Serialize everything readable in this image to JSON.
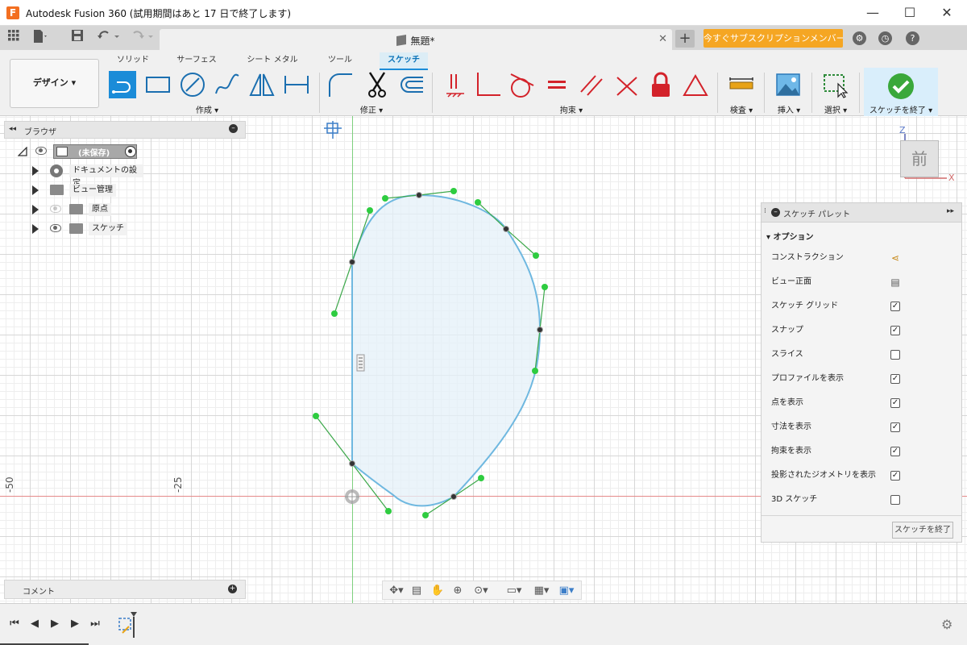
{
  "window": {
    "logo_letter": "F",
    "title": "Autodesk Fusion 360 (試用期間はあと 17 日で終了します)",
    "controls": {
      "minimize": "—",
      "maximize": "☐",
      "close": "✕"
    }
  },
  "tabbar": {
    "doc_tab_title": "無題*",
    "close": "✕",
    "new_tab": "+",
    "subscription_button": "今すぐサブスクリプションメンバーに...",
    "icons": [
      "grid-icon",
      "file-icon",
      "save-icon",
      "undo-icon",
      "redo-icon",
      "job-status-icon",
      "history-icon",
      "help-icon"
    ]
  },
  "ribbon": {
    "workspace": "デザイン ▾",
    "tabs": [
      {
        "label": "ソリッド",
        "active": false
      },
      {
        "label": "サーフェス",
        "active": false
      },
      {
        "label": "シート メタル",
        "active": false
      },
      {
        "label": "ツール",
        "active": false
      },
      {
        "label": "スケッチ",
        "active": true
      }
    ],
    "groups": {
      "create": "作成 ▾",
      "modify": "修正 ▾",
      "constraints": "拘束 ▾",
      "inspect": "検査 ▾",
      "insert": "挿入 ▾",
      "select": "選択 ▾",
      "finish": "スケッチを終了 ▾"
    },
    "accent": "#1b8cd8",
    "constraint_red": "#d3222a"
  },
  "browser": {
    "title": "ブラウザ",
    "root": "(未保存)",
    "items": [
      {
        "label": "ドキュメントの設定",
        "icon": "gear-icon"
      },
      {
        "label": "ビュー管理",
        "icon": "folder-icon"
      },
      {
        "label": "原点",
        "icon": "folder-icon"
      },
      {
        "label": "スケッチ",
        "icon": "folder-icon"
      }
    ]
  },
  "canvas": {
    "scale_labels": [
      "-50",
      "-25"
    ],
    "spline_color": "#6fb8e0",
    "handle_color": "#2ecc40"
  },
  "viewcube": {
    "face": "前",
    "axis_z": "Z",
    "axis_x": "X"
  },
  "comments": {
    "title": "コメント"
  },
  "palette": {
    "title": "スケッチ パレット",
    "section": "オプション",
    "rows": [
      {
        "label": "コンストラクション",
        "type": "icon"
      },
      {
        "label": "ビュー正面",
        "type": "icon"
      },
      {
        "label": "スケッチ グリッド",
        "type": "checkbox",
        "checked": true
      },
      {
        "label": "スナップ",
        "type": "checkbox",
        "checked": true
      },
      {
        "label": "スライス",
        "type": "checkbox",
        "checked": false
      },
      {
        "label": "プロファイルを表示",
        "type": "checkbox",
        "checked": true
      },
      {
        "label": "点を表示",
        "type": "checkbox",
        "checked": true
      },
      {
        "label": "寸法を表示",
        "type": "checkbox",
        "checked": true
      },
      {
        "label": "拘束を表示",
        "type": "checkbox",
        "checked": true
      },
      {
        "label": "投影されたジオメトリを表示",
        "type": "checkbox",
        "checked": true
      },
      {
        "label": "3D スケッチ",
        "type": "checkbox",
        "checked": false
      }
    ],
    "finish_button": "スケッチを終了"
  }
}
